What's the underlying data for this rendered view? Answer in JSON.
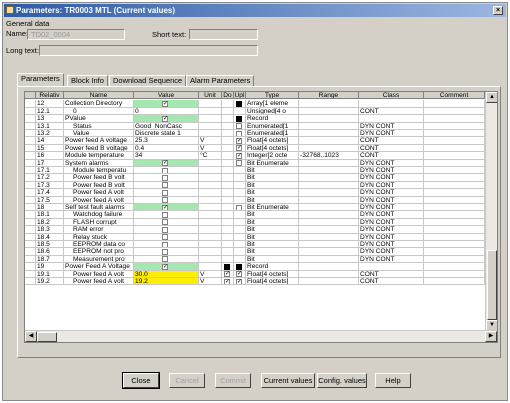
{
  "window": {
    "title": "Parameters: TR0003 MTL (Current values)",
    "close_glyph": "×"
  },
  "general": {
    "group_label": "General data",
    "name_label": "Name:",
    "name_value": "TD02_0004",
    "short_text_label": "Short text:",
    "short_text_value": "",
    "long_text_label": "Long text:",
    "long_text_value": ""
  },
  "tabs": [
    "Parameters",
    "Block Info",
    "Download Sequence",
    "Alarm Parameters"
  ],
  "columns": [
    "Relativ",
    "Name",
    "Value",
    "Unit",
    "Do",
    "Upl",
    "Type",
    "Range",
    "Class",
    "Comment"
  ],
  "rows": [
    {
      "rel": "12",
      "name": "Collection Directory",
      "value": "",
      "unit": "",
      "do": "",
      "upl": "blk",
      "type": "Array[1 eleme",
      "range": "",
      "cls": "",
      "vstyle": "green",
      "cb": "checked"
    },
    {
      "rel": "12.1",
      "name": "0",
      "value": "0",
      "unit": "",
      "do": "",
      "upl": "",
      "type": "Unsigned[4 o",
      "range": "",
      "cls": "CONT",
      "vstyle": "",
      "cb": ""
    },
    {
      "rel": "13",
      "name": "PValue",
      "value": "",
      "unit": "",
      "do": "",
      "upl": "blk",
      "type": "Record",
      "range": "",
      "cls": "",
      "vstyle": "green",
      "cb": "checked"
    },
    {
      "rel": "13.1",
      "name": "Status",
      "value": "Good_NonCasc",
      "unit": "",
      "do": "",
      "upl": "box",
      "type": "Enumerated[1",
      "range": "",
      "cls": "DYN CONT",
      "vstyle": "",
      "cb": ""
    },
    {
      "rel": "13.2",
      "name": "Value",
      "value": "Discrete state 1",
      "unit": "",
      "do": "",
      "upl": "box",
      "type": "Enumerated[1",
      "range": "",
      "cls": "DYN CONT",
      "vstyle": "",
      "cb": ""
    },
    {
      "rel": "14",
      "name": "Power feed A voltage",
      "value": "25.3",
      "unit": "V",
      "do": "",
      "upl": "chk",
      "type": "Float[4 octets]",
      "range": "",
      "cls": "CONT",
      "vstyle": "",
      "cb": ""
    },
    {
      "rel": "15",
      "name": "Power feed B voltage",
      "value": "0.4",
      "unit": "V",
      "do": "",
      "upl": "chk",
      "type": "Float[4 octets]",
      "range": "",
      "cls": "CONT",
      "vstyle": "",
      "cb": ""
    },
    {
      "rel": "16",
      "name": "Module temperature",
      "value": "34",
      "unit": "°C",
      "do": "",
      "upl": "chk",
      "type": "Integer[2 octe",
      "range": "-32768..1023",
      "cls": "CONT",
      "vstyle": "",
      "cb": ""
    },
    {
      "rel": "17",
      "name": "System alarms",
      "value": "",
      "unit": "",
      "do": "",
      "upl": "box",
      "type": "Bit Enumerate",
      "range": "",
      "cls": "DYN CONT",
      "vstyle": "green",
      "cb": "checked"
    },
    {
      "rel": "17.1",
      "name": "Module temperatu",
      "value": "",
      "unit": "",
      "do": "",
      "upl": "",
      "type": "Bit",
      "range": "",
      "cls": "DYN CONT",
      "vstyle": "",
      "cb": "box"
    },
    {
      "rel": "17.2",
      "name": "Power feed B volt",
      "value": "",
      "unit": "",
      "do": "",
      "upl": "",
      "type": "Bit",
      "range": "",
      "cls": "DYN CONT",
      "vstyle": "",
      "cb": "box"
    },
    {
      "rel": "17.3",
      "name": "Power feed B volt",
      "value": "",
      "unit": "",
      "do": "",
      "upl": "",
      "type": "Bit",
      "range": "",
      "cls": "DYN CONT",
      "vstyle": "",
      "cb": "box"
    },
    {
      "rel": "17.4",
      "name": "Power feed A volt",
      "value": "",
      "unit": "",
      "do": "",
      "upl": "",
      "type": "Bit",
      "range": "",
      "cls": "DYN CONT",
      "vstyle": "",
      "cb": "box"
    },
    {
      "rel": "17.5",
      "name": "Power feed A volt",
      "value": "",
      "unit": "",
      "do": "",
      "upl": "",
      "type": "Bit",
      "range": "",
      "cls": "DYN CONT",
      "vstyle": "",
      "cb": "box"
    },
    {
      "rel": "18",
      "name": "Self test fault alarms",
      "value": "",
      "unit": "",
      "do": "",
      "upl": "box",
      "type": "Bit Enumerate",
      "range": "",
      "cls": "DYN CONT",
      "vstyle": "green",
      "cb": "checked"
    },
    {
      "rel": "18.1",
      "name": "Watchdog failure",
      "value": "",
      "unit": "",
      "do": "",
      "upl": "",
      "type": "Bit",
      "range": "",
      "cls": "DYN CONT",
      "vstyle": "",
      "cb": "box"
    },
    {
      "rel": "18.2",
      "name": "FLASH corrupt",
      "value": "",
      "unit": "",
      "do": "",
      "upl": "",
      "type": "Bit",
      "range": "",
      "cls": "DYN CONT",
      "vstyle": "",
      "cb": "box"
    },
    {
      "rel": "18.3",
      "name": "RAM error",
      "value": "",
      "unit": "",
      "do": "",
      "upl": "",
      "type": "Bit",
      "range": "",
      "cls": "DYN CONT",
      "vstyle": "",
      "cb": "box"
    },
    {
      "rel": "18.4",
      "name": "Relay stuck",
      "value": "",
      "unit": "",
      "do": "",
      "upl": "",
      "type": "Bit",
      "range": "",
      "cls": "DYN CONT",
      "vstyle": "",
      "cb": "box"
    },
    {
      "rel": "18.5",
      "name": "EEPROM data co",
      "value": "",
      "unit": "",
      "do": "",
      "upl": "",
      "type": "Bit",
      "range": "",
      "cls": "DYN CONT",
      "vstyle": "",
      "cb": "box"
    },
    {
      "rel": "18.6",
      "name": "EEPROM not pro",
      "value": "",
      "unit": "",
      "do": "",
      "upl": "",
      "type": "Bit",
      "range": "",
      "cls": "DYN CONT",
      "vstyle": "",
      "cb": "box"
    },
    {
      "rel": "18.7",
      "name": "Measurement pro",
      "value": "",
      "unit": "",
      "do": "",
      "upl": "",
      "type": "Bit",
      "range": "",
      "cls": "DYN CONT",
      "vstyle": "",
      "cb": "box"
    },
    {
      "rel": "19",
      "name": "Power Feed A Voltage",
      "value": "",
      "unit": "",
      "do": "blk",
      "upl": "blk",
      "type": "Record",
      "range": "",
      "cls": "",
      "vstyle": "green",
      "cb": "checked"
    },
    {
      "rel": "19.1",
      "name": "Power feed A volt",
      "value": "30.0",
      "unit": "V",
      "do": "chk",
      "upl": "chk",
      "type": "Float[4 octets]",
      "range": "",
      "cls": "CONT",
      "vstyle": "yellow",
      "cb": ""
    },
    {
      "rel": "19.2",
      "name": "Power feed A volt",
      "value": "19.2",
      "unit": "V",
      "do": "chk",
      "upl": "chk",
      "type": "Float[4 octets]",
      "range": "",
      "cls": "CONT",
      "vstyle": "yellow",
      "cb": ""
    }
  ],
  "buttons": {
    "close": "Close",
    "cancel": "Cancel",
    "commit": "Commit",
    "current_values": "Current values",
    "config_values": "Config. values",
    "help": "Help"
  },
  "colors": {
    "green_cell": "#a6e6b0",
    "yellow_cell": "#ffee00",
    "title_bar": "#2e5ba5"
  }
}
